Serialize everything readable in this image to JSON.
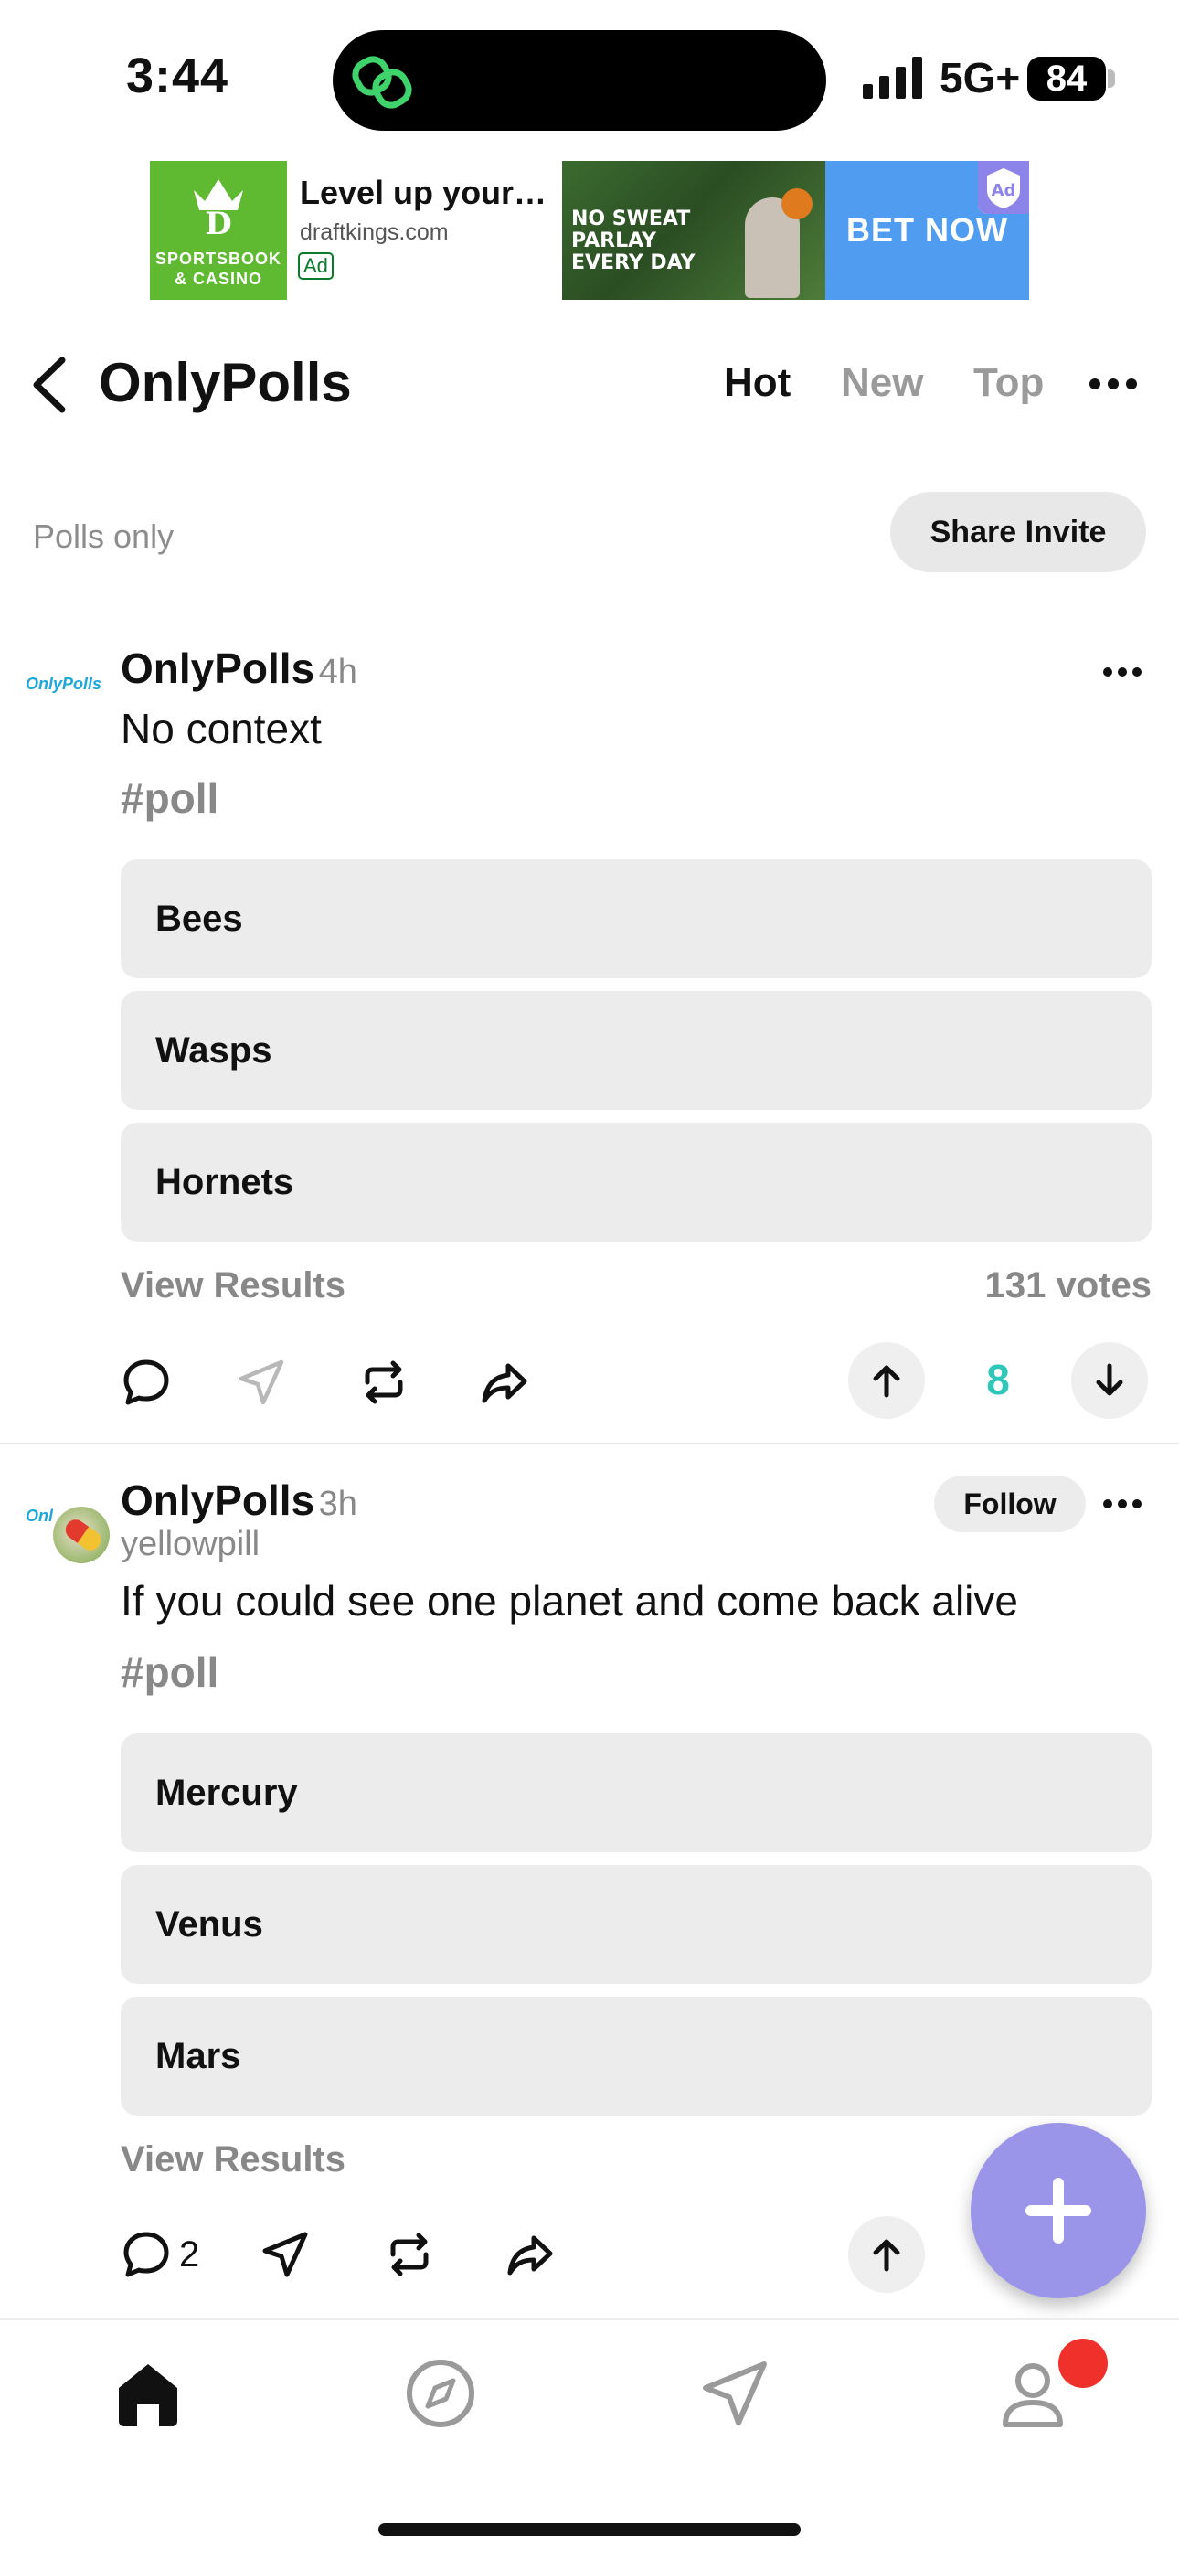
{
  "status_bar": {
    "time": "3:44",
    "carrier": "5G+",
    "battery": "84"
  },
  "ad": {
    "logo_text": "SPORTSBOOK & CASINO",
    "title": "Level up your…",
    "domain": "draftkings.com",
    "badge": "Ad",
    "photo_text": "NO SWEAT PARLAY EVERY DAY",
    "cta": "BET NOW"
  },
  "header": {
    "title": "OnlyPolls",
    "tabs": [
      {
        "label": "Hot",
        "active": true
      },
      {
        "label": "New",
        "active": false
      },
      {
        "label": "Top",
        "active": false
      }
    ]
  },
  "subheader": {
    "label": "Polls only",
    "share_label": "Share Invite"
  },
  "posts": [
    {
      "logo": "OnlyPolls",
      "author": "OnlyPolls",
      "time": "4h",
      "text": "No context",
      "hashtag": "#poll",
      "options": [
        "Bees",
        "Wasps",
        "Hornets"
      ],
      "view_results": "View Results",
      "votes": "131 votes",
      "score": "8"
    },
    {
      "logo": "Onl",
      "author": "OnlyPolls",
      "time": "3h",
      "follow": "Follow",
      "username": "yellowpill",
      "text": "If you could see one planet and come back alive",
      "hashtag": "#poll",
      "options": [
        "Mercury",
        "Venus",
        "Mars"
      ],
      "view_results": "View Results",
      "comments": "2"
    }
  ],
  "colors": {
    "score": "#2ec7b8",
    "fab": "#9b95ea",
    "notification": "#f0302b",
    "ad_green": "#5fb931",
    "ad_blue": "#4f9cf0"
  },
  "nav": {
    "items": [
      "home-icon",
      "explore-icon",
      "send-icon",
      "profile-icon"
    ]
  }
}
